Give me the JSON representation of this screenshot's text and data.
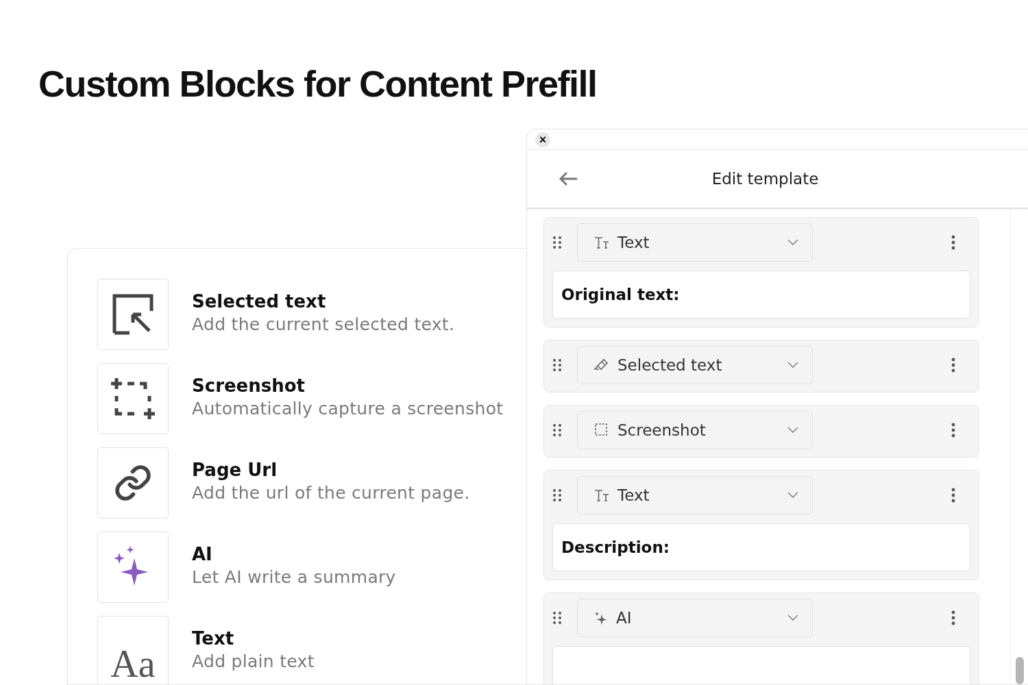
{
  "heading": "Custom Blocks for Content Prefill",
  "blocks_menu": [
    {
      "kind": "selected_text",
      "title": "Selected text",
      "description": "Add the current selected text."
    },
    {
      "kind": "screenshot",
      "title": "Screenshot",
      "description": "Automatically capture a screenshot"
    },
    {
      "kind": "page_url",
      "title": "Page Url",
      "description": "Add the url of the current page."
    },
    {
      "kind": "ai",
      "title": "AI",
      "description": "Let AI write a summary"
    },
    {
      "kind": "text",
      "glyph": "Aa",
      "title": "Text",
      "description": "Add plain text"
    }
  ],
  "panel": {
    "close": "×",
    "title": "Edit template",
    "template_blocks": [
      {
        "kind": "text",
        "label": "Text",
        "has_field": true,
        "value": "Original text:"
      },
      {
        "kind": "selected_text",
        "label": "Selected text",
        "has_field": false
      },
      {
        "kind": "screenshot",
        "label": "Screenshot",
        "has_field": false
      },
      {
        "kind": "text",
        "label": "Text",
        "has_field": true,
        "value": "Description:"
      },
      {
        "kind": "ai",
        "label": "AI",
        "has_field": true
      }
    ]
  }
}
